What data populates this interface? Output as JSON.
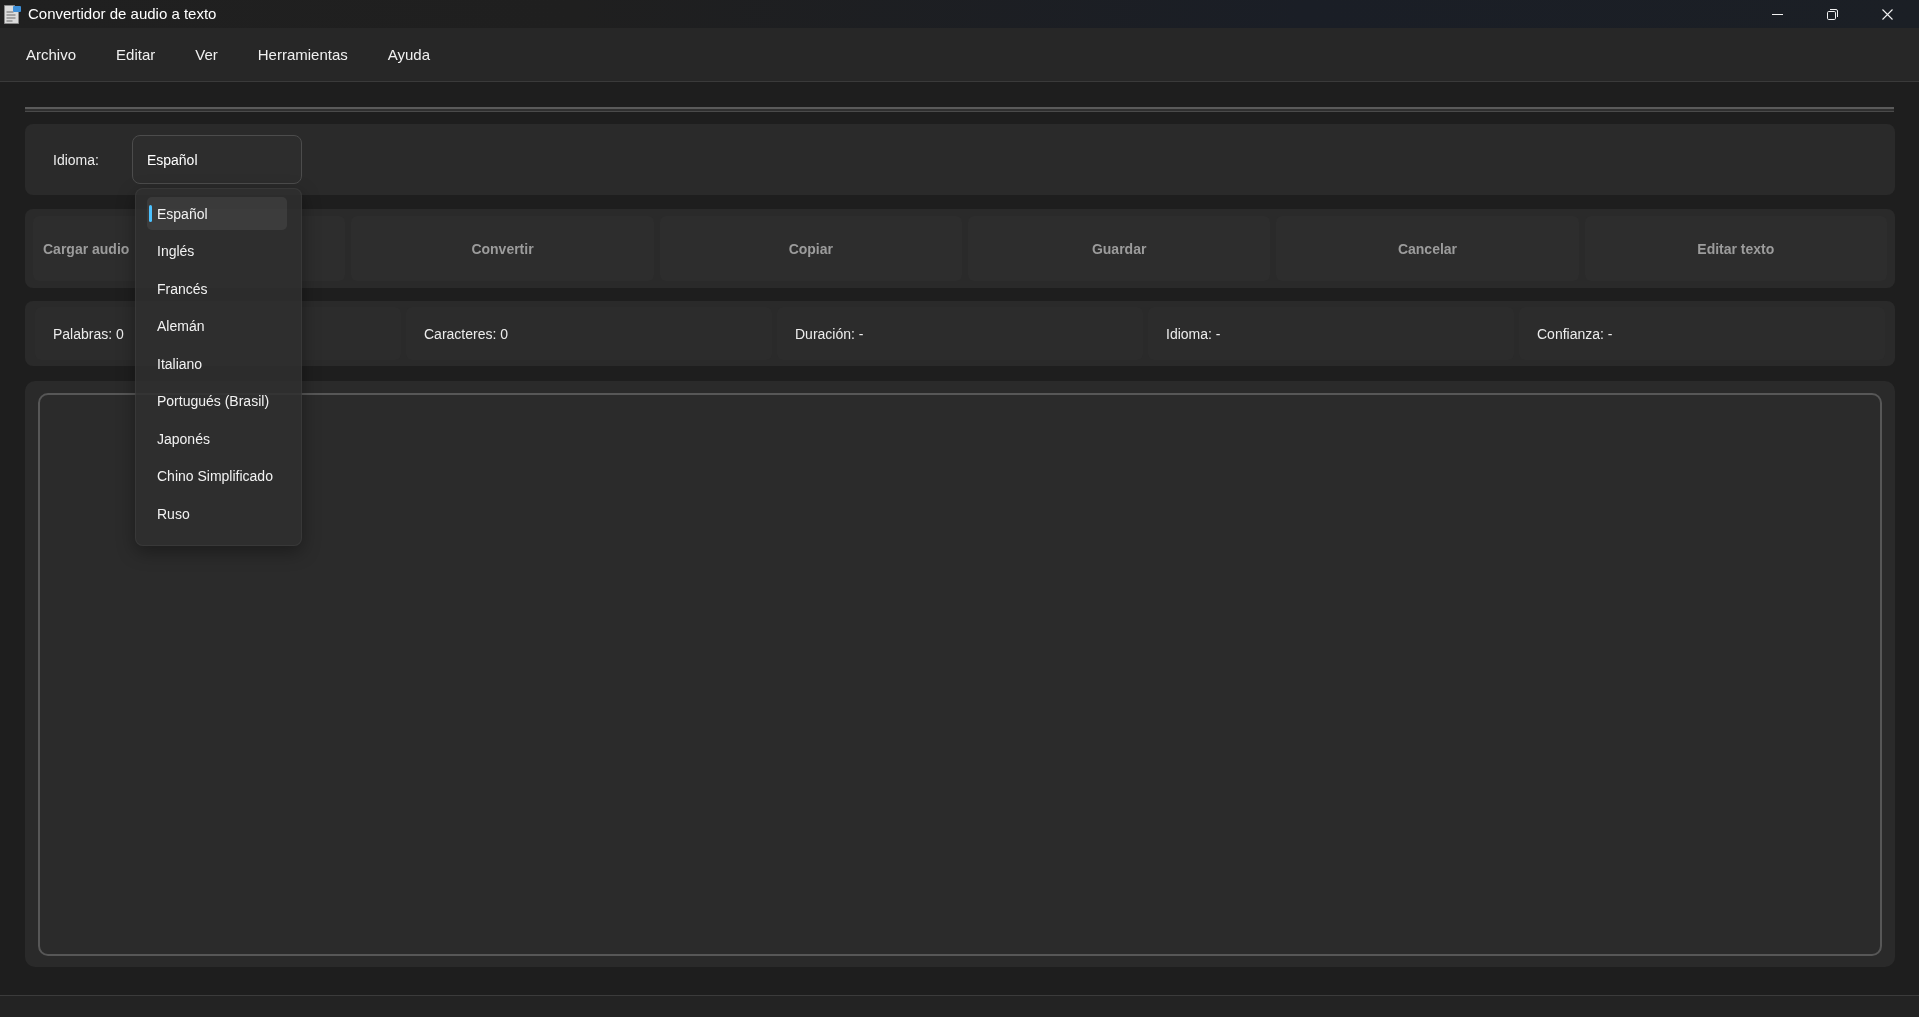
{
  "window": {
    "title": "Convertidor de audio a texto"
  },
  "menu": [
    "Archivo",
    "Editar",
    "Ver",
    "Herramientas",
    "Ayuda"
  ],
  "language": {
    "label": "Idioma:",
    "value": "Español",
    "expanded": true,
    "options": [
      {
        "label": "Español",
        "selected": true
      },
      {
        "label": "Inglés",
        "selected": false
      },
      {
        "label": "Francés",
        "selected": false
      },
      {
        "label": "Alemán",
        "selected": false
      },
      {
        "label": "Italiano",
        "selected": false
      },
      {
        "label": "Portugués (Brasil)",
        "selected": false
      },
      {
        "label": "Japonés",
        "selected": false
      },
      {
        "label": "Chino Simplificado",
        "selected": false
      },
      {
        "label": "Ruso",
        "selected": false
      }
    ]
  },
  "buttons": [
    "Cargar audio",
    "Convertir",
    "Copiar",
    "Guardar",
    "Cancelar",
    "Editar texto"
  ],
  "stats": [
    "Palabras: 0",
    "Caracteres: 0",
    "Duración: -",
    "Idioma: -",
    "Confianza: -"
  ]
}
